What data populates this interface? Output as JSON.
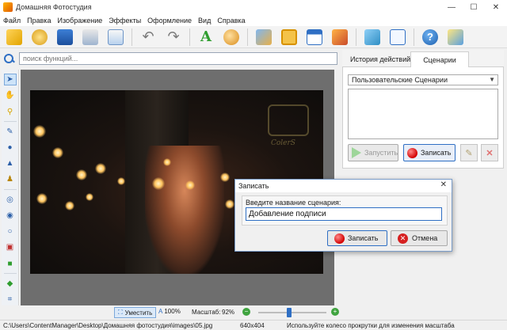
{
  "window": {
    "title": "Домашняя Фотостудия",
    "minimize": "—",
    "maximize": "☐",
    "close": "✕"
  },
  "menu": [
    "Файл",
    "Правка",
    "Изображение",
    "Эффекты",
    "Оформление",
    "Вид",
    "Справка"
  ],
  "toolbar_icons": [
    "open-icon",
    "effects-icon",
    "save-icon",
    "print-icon",
    "preview-icon",
    "undo-icon",
    "redo-icon",
    "text-icon",
    "palette-icon",
    "frame-icon",
    "collage-icon",
    "calendar-icon",
    "postcard-icon",
    "fit-icon",
    "actual-size-icon",
    "help-icon",
    "package-icon"
  ],
  "search": {
    "placeholder": "поиск функций...",
    "value": ""
  },
  "left_tools": [
    "pointer-icon",
    "hand-icon",
    "magnifier-icon",
    "brush-icon",
    "drop-icon",
    "triangle-icon",
    "stamp-icon",
    "selection-ellipse-icon",
    "eye-icon",
    "lasso-icon",
    "layers-icon",
    "color-icon",
    "eraser-icon",
    "crop-icon"
  ],
  "photo": {
    "watermark_text": "ColerS"
  },
  "right_panel": {
    "tabs": [
      "История действий",
      "Сценарии"
    ],
    "active_tab": 1,
    "scenario_select": "Пользовательские Сценарии",
    "run_button": "Запустить",
    "record_button": "Записать"
  },
  "dialog": {
    "title": "Записать",
    "label": "Введите название сценария:",
    "input_value": "Добавление подписи",
    "ok": "Записать",
    "cancel": "Отмена",
    "close": "✕"
  },
  "zoom": {
    "fit_label": "Уместить",
    "actual_label": "100%",
    "scale_label": "Масштаб:",
    "scale_value": "92%",
    "slider_fraction": 0.45
  },
  "status": {
    "path": "C:\\Users\\ContentManager\\Desktop\\Домашняя фотостудия\\images\\05.jpg",
    "size": "640x404",
    "hint": "Используйте колесо прокрутки для изменения масштаба"
  },
  "colors": {
    "accent": "#2f6fc4",
    "record": "#d40000",
    "green": "#3fa33f"
  }
}
